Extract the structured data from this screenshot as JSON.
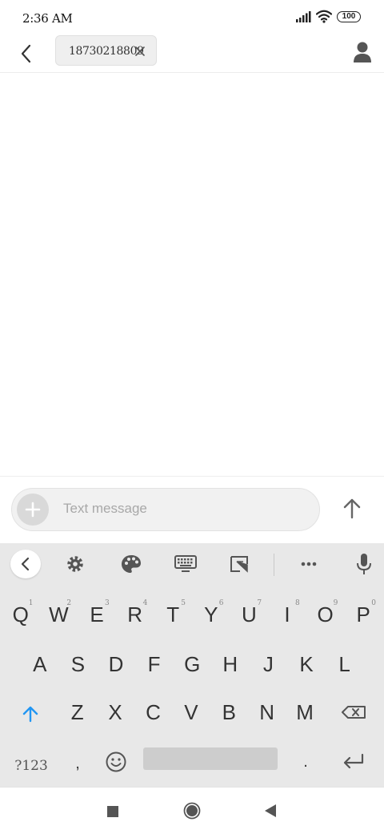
{
  "status_bar": {
    "time": "2:36 AM",
    "battery": "100",
    "icons": [
      "signal-icon",
      "wifi-icon",
      "battery-icon"
    ]
  },
  "header": {
    "recipient_chip": "18730218809",
    "icons": [
      "back-arrow-icon",
      "close-icon",
      "contact-person-icon"
    ]
  },
  "compose": {
    "placeholder": "Text message",
    "value": "",
    "icons": [
      "plus-icon",
      "send-arrow-up-icon"
    ]
  },
  "keyboard": {
    "toolbar": [
      "chevron-left-icon",
      "gear-icon",
      "palette-icon",
      "keyboard-icon",
      "resize-icon",
      "more-dots-icon",
      "microphone-icon"
    ],
    "row1": [
      {
        "key": "Q",
        "hint": "1"
      },
      {
        "key": "W",
        "hint": "2"
      },
      {
        "key": "E",
        "hint": "3"
      },
      {
        "key": "R",
        "hint": "4"
      },
      {
        "key": "T",
        "hint": "5"
      },
      {
        "key": "Y",
        "hint": "6"
      },
      {
        "key": "U",
        "hint": "7"
      },
      {
        "key": "I",
        "hint": "8"
      },
      {
        "key": "O",
        "hint": "9"
      },
      {
        "key": "P",
        "hint": "0"
      }
    ],
    "row2": [
      "A",
      "S",
      "D",
      "F",
      "G",
      "H",
      "J",
      "K",
      "L"
    ],
    "row3": [
      "Z",
      "X",
      "C",
      "V",
      "B",
      "N",
      "M"
    ],
    "row4": {
      "symbols": "?123",
      "comma": ",",
      "period": ".",
      "icons": [
        "shift-arrow-icon",
        "backspace-icon",
        "emoji-icon",
        "enter-icon"
      ]
    },
    "accent_color": "#2196f3"
  },
  "nav_bar": {
    "icons": [
      "square-recents-icon",
      "circle-home-icon",
      "triangle-back-icon"
    ]
  }
}
